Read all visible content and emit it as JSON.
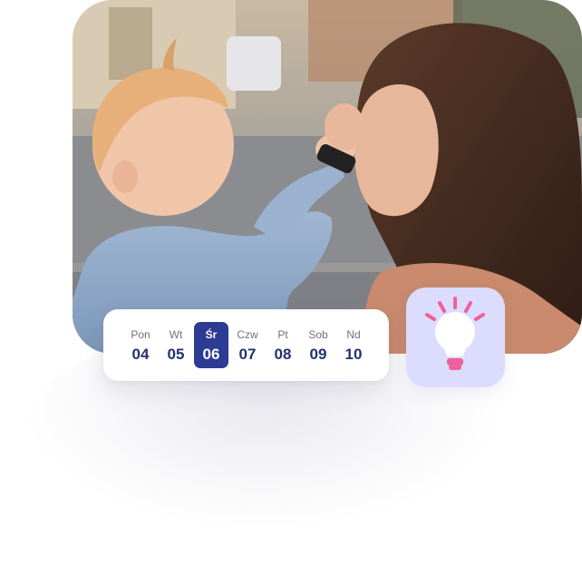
{
  "calendar": {
    "days": [
      {
        "name": "Pon",
        "num": "04"
      },
      {
        "name": "Wt",
        "num": "05"
      },
      {
        "name": "Śr",
        "num": "06"
      },
      {
        "name": "Czw",
        "num": "07"
      },
      {
        "name": "Pt",
        "num": "08"
      },
      {
        "name": "Sob",
        "num": "09"
      },
      {
        "name": "Nd",
        "num": "10"
      }
    ],
    "selected_day": "Śr"
  },
  "icons": {
    "idea": "lightbulb-icon"
  },
  "colors": {
    "selected_day_bg": "#2c3c92",
    "day_number": "#23326e",
    "bulb_tile_bg": "#dcdcff",
    "bulb_rays": "#f0609a"
  }
}
